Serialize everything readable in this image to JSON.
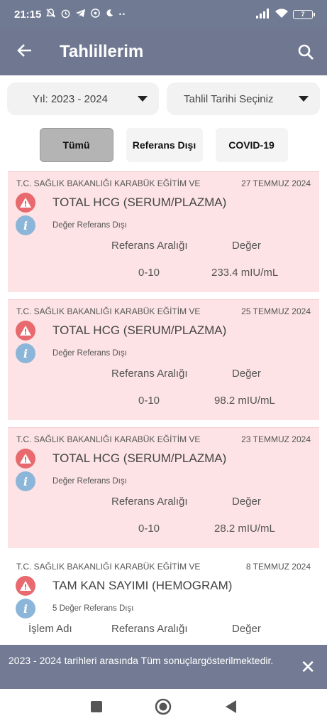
{
  "status_bar": {
    "time": "21:15",
    "battery": "7"
  },
  "appbar": {
    "title": "Tahlillerim"
  },
  "filters": {
    "year": "Yıl: 2023 - 2024",
    "date": "Tahlil Tarihi Seçiniz"
  },
  "tabs": [
    {
      "label": "Tümü",
      "active": true
    },
    {
      "label": "Referans Dışı"
    },
    {
      "label": "COVID-19"
    }
  ],
  "columns": {
    "name": "İşlem Adı",
    "range": "Referans Aralığı",
    "value": "Değer"
  },
  "results": [
    {
      "institution": "T.C. SAĞLIK BAKANLIĞI KARABÜK EĞİTİM VE",
      "date": "27 TEMMUZ 2024",
      "test": "TOTAL HCG (SERUM/PLAZMA)",
      "status": "Değer Referans Dışı",
      "range": "0-10",
      "value": "233.4 mIU/mL"
    },
    {
      "institution": "T.C. SAĞLIK BAKANLIĞI KARABÜK EĞİTİM VE",
      "date": "25 TEMMUZ 2024",
      "test": "TOTAL HCG (SERUM/PLAZMA)",
      "status": "Değer Referans Dışı",
      "range": "0-10",
      "value": "98.2 mIU/mL"
    },
    {
      "institution": "T.C. SAĞLIK BAKANLIĞI KARABÜK EĞİTİM VE",
      "date": "23 TEMMUZ 2024",
      "test": "TOTAL HCG (SERUM/PLAZMA)",
      "status": "Değer Referans Dışı",
      "range": "0-10",
      "value": "28.2 mIU/mL"
    },
    {
      "institution": "T.C. SAĞLIK BAKANLIĞI KARABÜK EĞİTİM VE",
      "date": "8 TEMMUZ 2024",
      "test": "TAM KAN SAYIMI (HEMOGRAM)",
      "status": "5 Değer Referans Dışı"
    }
  ],
  "snackbar": {
    "message": "2023 - 2024 tarihleri arasında Tüm sonuçlargösterilmektedir."
  },
  "colors": {
    "header": "#6f7890",
    "card_bg": "#fde3e5",
    "warning": "#e86a6f",
    "info": "#8cb6d9"
  }
}
